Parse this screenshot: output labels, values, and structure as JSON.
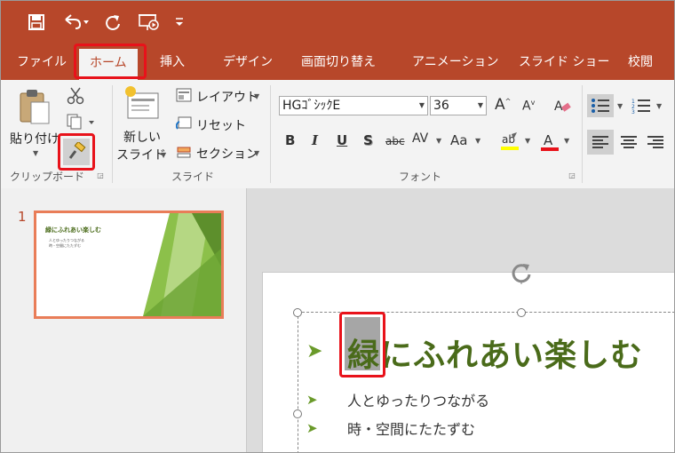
{
  "colors": {
    "accent": "#b7472a",
    "highlight_box": "#e8121a",
    "title_green": "#4a6b1a",
    "bullet_green": "#6a9a2a"
  },
  "quick_access": [
    {
      "name": "save-icon"
    },
    {
      "name": "undo-icon"
    },
    {
      "name": "redo-icon"
    },
    {
      "name": "start-slideshow-icon"
    },
    {
      "name": "customize-qat-icon"
    }
  ],
  "tabs": [
    "ファイル",
    "ホーム",
    "挿入",
    "デザイン",
    "画面切り替え",
    "アニメーション",
    "スライド ショー",
    "校閲"
  ],
  "active_tab": "ホーム",
  "ribbon": {
    "clipboard": {
      "paste_label": "貼り付け",
      "group_label": "クリップボード"
    },
    "slides": {
      "new_slide_label_1": "新しい",
      "new_slide_label_2": "スライド",
      "layout_label": "レイアウト",
      "reset_label": "リセット",
      "section_label": "セクション",
      "group_label": "スライド"
    },
    "font": {
      "font_name": "HGｺﾞｼｯｸE",
      "font_size": "36",
      "bold": "B",
      "italic": "I",
      "underline": "U",
      "shadow": "S",
      "strike": "abc",
      "spacing": "AV",
      "case": "Aa",
      "group_label": "フォント"
    }
  },
  "thumbnail": {
    "number": "1",
    "title": "緑にふれあい楽しむ",
    "bullets": [
      "人とゆったりつながる",
      "時・空間にたたずむ"
    ]
  },
  "slide": {
    "title": "緑にふれあい楽しむ",
    "bullets": [
      "人とゆったりつながる",
      "時・空間にたたずむ"
    ]
  }
}
